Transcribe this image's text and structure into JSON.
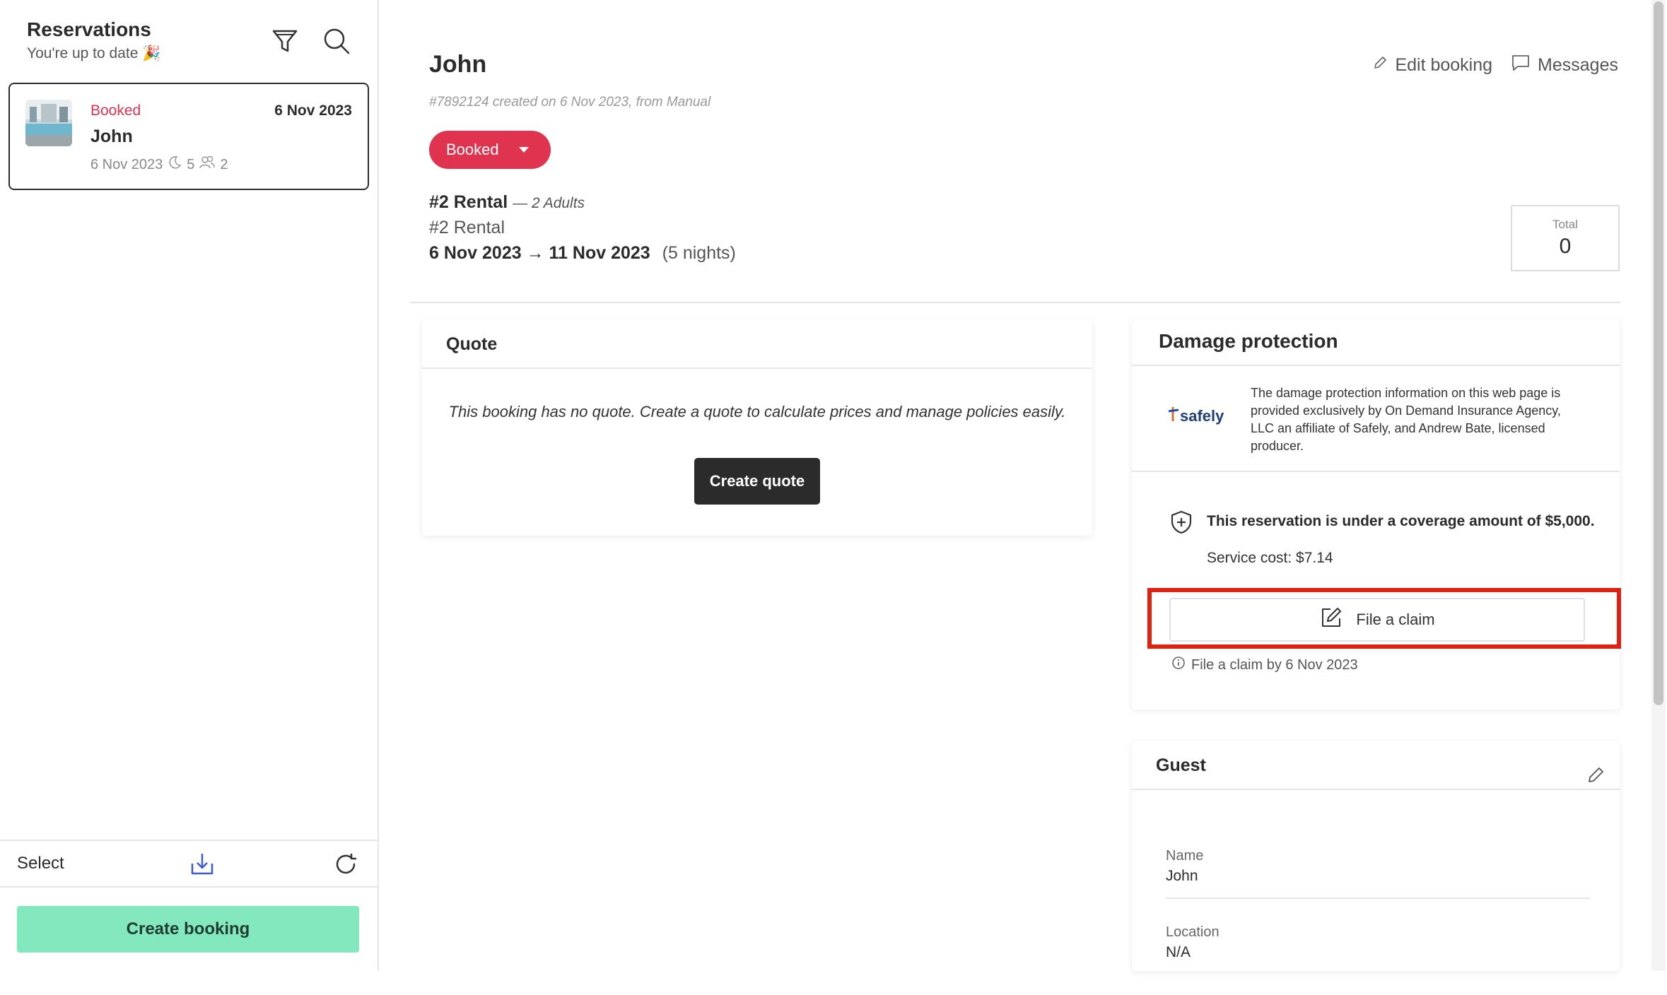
{
  "sidebar": {
    "title": "Reservations",
    "subtitle": "You're up to date 🎉",
    "reservation": {
      "status": "Booked",
      "date": "6 Nov 2023",
      "name": "John",
      "meta_date": "6 Nov 2023",
      "nights": "5",
      "guests": "2"
    },
    "select_label": "Select",
    "create_booking_label": "Create booking"
  },
  "booking": {
    "guest_name": "John",
    "meta": "#7892124 created on 6 Nov 2023, from Manual",
    "edit_label": "Edit booking",
    "messages_label": "Messages",
    "status": "Booked",
    "rental_name": "#2 Rental",
    "rental_guests": "— 2 Adults",
    "rental_subname": "#2 Rental",
    "date_from": "6 Nov 2023",
    "date_to": "11 Nov 2023",
    "nights": "(5 nights)",
    "total_label": "Total",
    "total_value": "0"
  },
  "quote": {
    "title": "Quote",
    "message": "This booking has no quote. Create a quote to calculate prices and manage policies easily.",
    "button": "Create quote"
  },
  "damage": {
    "title": "Damage protection",
    "logo_text": "safely",
    "info": "The damage protection information on this web page is provided exclusively by On Demand Insurance Agency, LLC an affiliate of Safely, and Andrew Bate, licensed producer.",
    "coverage": "This reservation is under a coverage amount of $5,000.",
    "service_cost": "Service cost: $7.14",
    "file_claim": "File a claim",
    "claim_deadline": "File a claim by 6 Nov 2023"
  },
  "guest": {
    "title": "Guest",
    "name_label": "Name",
    "name_value": "John",
    "location_label": "Location",
    "location_value": "N/A"
  },
  "colors": {
    "booked": "#e0334f",
    "create_booking": "#84e8bf",
    "highlight": "#e02010",
    "dark_button": "#2b2b2b"
  }
}
